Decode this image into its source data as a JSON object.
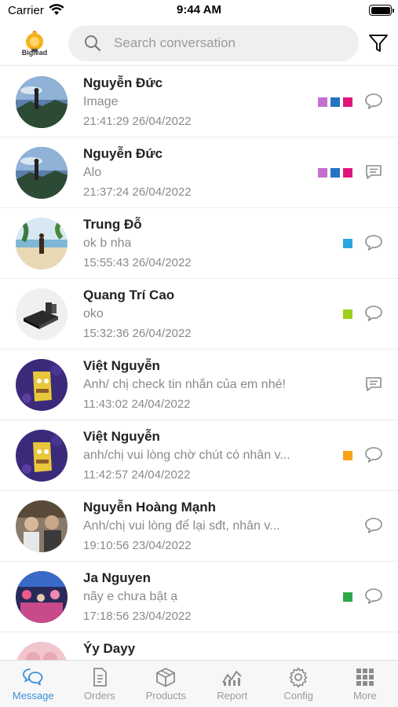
{
  "status_bar": {
    "carrier": "Carrier",
    "time": "9:44 AM"
  },
  "header": {
    "logo_text": "Biglead",
    "search_placeholder": "Search conversation"
  },
  "colors": {
    "accent": "#3b8fd8",
    "text_muted": "#8a8a8a",
    "icon_gray": "#8c8c8c"
  },
  "conversations": [
    {
      "name": "Nguyễn Đức",
      "message": "Image",
      "time": "21:41:29 26/04/2022",
      "tags": [
        "#c36fd0",
        "#2473c4",
        "#e0157c"
      ],
      "icon": "chat-bubble-icon",
      "avatar": "landscape-avatar"
    },
    {
      "name": "Nguyễn Đức",
      "message": "Alo",
      "time": "21:37:24 26/04/2022",
      "tags": [
        "#c36fd0",
        "#2473c4",
        "#e0157c"
      ],
      "icon": "chat-text-icon",
      "avatar": "landscape-avatar"
    },
    {
      "name": "Trung Đỗ",
      "message": "ok b nha",
      "time": "15:55:43 26/04/2022",
      "tags": [
        "#29a8e0"
      ],
      "icon": "chat-bubble-icon",
      "avatar": "beach-avatar"
    },
    {
      "name": "Quang Trí Cao",
      "message": "oko",
      "time": "15:32:36 26/04/2022",
      "tags": [
        "#9ccf1c"
      ],
      "icon": "chat-bubble-icon",
      "avatar": "device-avatar"
    },
    {
      "name": "Việt Nguyễn",
      "message": "Anh/ chị check tin nhắn của em nhé!",
      "time": "11:43:02 24/04/2022",
      "tags": [],
      "icon": "chat-text-icon",
      "avatar": "cartoon-avatar"
    },
    {
      "name": "Việt Nguyễn",
      "message": "anh/chị vui lòng chờ chút có nhân v...",
      "time": "11:42:57 24/04/2022",
      "tags": [
        "#f5a416"
      ],
      "icon": "chat-bubble-icon",
      "avatar": "cartoon-avatar"
    },
    {
      "name": "Nguyễn Hoàng Mạnh",
      "message": "Anh/chị vui lòng để lại sđt, nhân v...",
      "time": "19:10:56 23/04/2022",
      "tags": [],
      "icon": "chat-bubble-icon",
      "avatar": "people-avatar"
    },
    {
      "name": "Ja Nguyen",
      "message": "nãy e chưa bật ạ",
      "time": "17:18:56 23/04/2022",
      "tags": [
        "#2ca84a"
      ],
      "icon": "chat-bubble-icon",
      "avatar": "party-avatar"
    },
    {
      "name": "Ýy Dayy",
      "message": "",
      "time": "",
      "tags": [],
      "icon": "",
      "avatar": "pink-avatar"
    }
  ],
  "tabs": [
    {
      "label": "Message",
      "icon": "message-icon",
      "active": true
    },
    {
      "label": "Orders",
      "icon": "orders-icon",
      "active": false
    },
    {
      "label": "Products",
      "icon": "products-icon",
      "active": false
    },
    {
      "label": "Report",
      "icon": "report-icon",
      "active": false
    },
    {
      "label": "Config",
      "icon": "config-icon",
      "active": false
    },
    {
      "label": "More",
      "icon": "more-icon",
      "active": false
    }
  ]
}
